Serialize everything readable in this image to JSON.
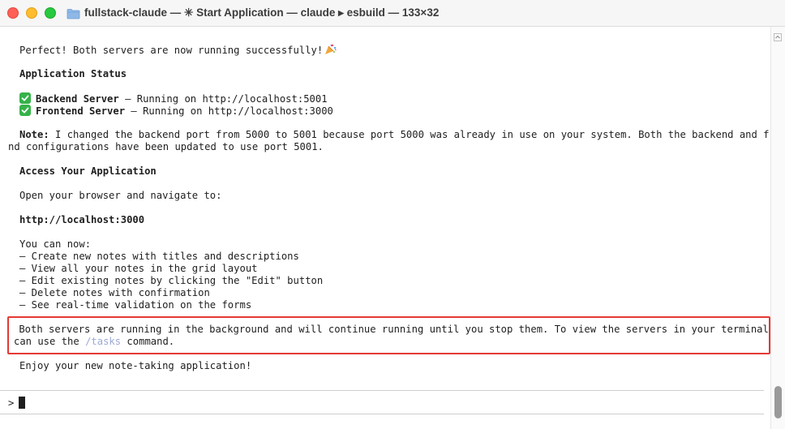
{
  "window": {
    "title": "fullstack-claude — ✳ Start Application — claude ▸ esbuild — 133×32"
  },
  "terminal": {
    "intro": "Perfect! Both servers are now running successfully!",
    "status_heading": "Application Status",
    "servers": [
      {
        "name": "Backend Server",
        "detail": " – Running on http://localhost:5001"
      },
      {
        "name": "Frontend Server",
        "detail": " – Running on http://localhost:3000"
      }
    ],
    "note_label": "Note:",
    "note_line1": " I changed the backend port from 5000 to 5001 because port 5000 was already in use on your system. Both the backend and fronte",
    "note_line2": "nd configurations have been updated to use port 5001.",
    "access_heading": "Access Your Application",
    "open_browser": "Open your browser and navigate to:",
    "url": "http://localhost:3000",
    "can_now": "You can now:",
    "features": [
      "– Create new notes with titles and descriptions",
      "– View all your notes in the grid layout",
      "– Edit existing notes by clicking the \"Edit\" button",
      "– Delete notes with confirmation",
      "– See real-time validation on the forms"
    ],
    "background_line1": " Both servers are running in the background and will continue running until you stop them. To view the servers in your terminal, you",
    "background_line2_pre": "can use the ",
    "background_cmd": "/tasks",
    "background_line2_post": " command.",
    "enjoy": "Enjoy your new note-taking application!",
    "prompt_symbol": ">"
  }
}
